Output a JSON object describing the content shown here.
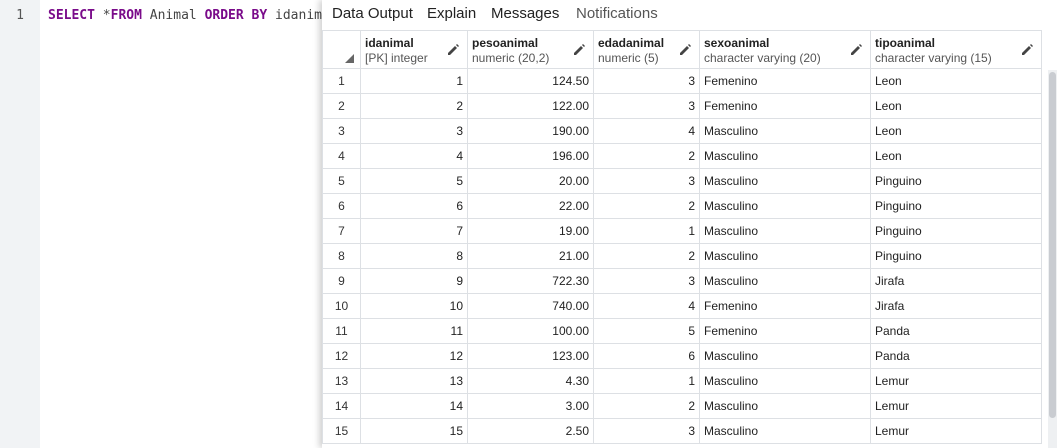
{
  "editor": {
    "line_number": "1",
    "tokens": [
      {
        "text": "SELECT",
        "kind": "kw"
      },
      {
        "text": " *",
        "kind": "tx"
      },
      {
        "text": "FROM",
        "kind": "kw"
      },
      {
        "text": " Animal ",
        "kind": "tx"
      },
      {
        "text": "ORDER BY",
        "kind": "kw"
      },
      {
        "text": " idanimal;",
        "kind": "tx"
      }
    ]
  },
  "results": {
    "tabs": [
      {
        "label": "Data Output",
        "active": true
      },
      {
        "label": "Explain",
        "active": true
      },
      {
        "label": "Messages",
        "active": true
      },
      {
        "label": "Notifications",
        "active": false
      }
    ],
    "columns": [
      {
        "name": "idanimal",
        "type": "[PK] integer",
        "align": "num"
      },
      {
        "name": "pesoanimal",
        "type": "numeric (20,2)",
        "align": "num"
      },
      {
        "name": "edadanimal",
        "type": "numeric (5)",
        "align": "num"
      },
      {
        "name": "sexoanimal",
        "type": "character varying (20)",
        "align": "txt"
      },
      {
        "name": "tipoanimal",
        "type": "character varying (15)",
        "align": "txt"
      }
    ],
    "rows": [
      [
        "1",
        "124.50",
        "3",
        "Femenino",
        "Leon"
      ],
      [
        "2",
        "122.00",
        "3",
        "Femenino",
        "Leon"
      ],
      [
        "3",
        "190.00",
        "4",
        "Masculino",
        "Leon"
      ],
      [
        "4",
        "196.00",
        "2",
        "Masculino",
        "Leon"
      ],
      [
        "5",
        "20.00",
        "3",
        "Masculino",
        "Pinguino"
      ],
      [
        "6",
        "22.00",
        "2",
        "Masculino",
        "Pinguino"
      ],
      [
        "7",
        "19.00",
        "1",
        "Masculino",
        "Pinguino"
      ],
      [
        "8",
        "21.00",
        "2",
        "Masculino",
        "Pinguino"
      ],
      [
        "9",
        "722.30",
        "3",
        "Masculino",
        "Jirafa"
      ],
      [
        "10",
        "740.00",
        "4",
        "Femenino",
        "Jirafa"
      ],
      [
        "11",
        "100.00",
        "5",
        "Femenino",
        "Panda"
      ],
      [
        "12",
        "123.00",
        "6",
        "Masculino",
        "Panda"
      ],
      [
        "13",
        "4.30",
        "1",
        "Masculino",
        "Lemur"
      ],
      [
        "14",
        "3.00",
        "2",
        "Masculino",
        "Lemur"
      ],
      [
        "15",
        "2.50",
        "3",
        "Masculino",
        "Lemur"
      ]
    ]
  }
}
